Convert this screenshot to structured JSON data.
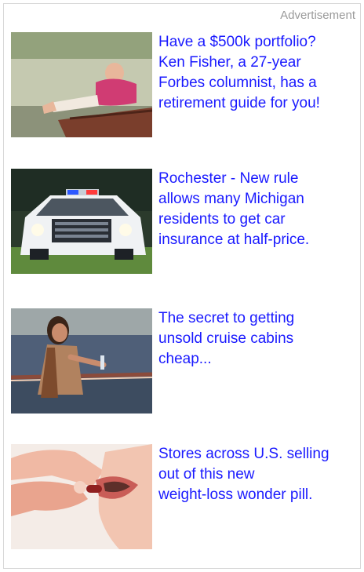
{
  "header": {
    "ad_label": "Advertisement"
  },
  "ads": [
    {
      "text": "Have a $500k portfolio?\nKen Fisher, a 27-year\nForbes columnist, has a\nretirement guide for you!",
      "icon": "lakeside-man-image"
    },
    {
      "text": "Rochester - New rule\nallows many Michigan\nresidents to get car\ninsurance at half-price.",
      "icon": "police-car-image"
    },
    {
      "text": "The secret to getting\nunsold cruise cabins\ncheap...",
      "icon": "cruise-woman-image"
    },
    {
      "text": "Stores across U.S. selling\nout of this new\nweight-loss wonder pill.",
      "icon": "pill-mouth-image"
    }
  ],
  "colors": {
    "link": "#1a1aff",
    "label": "#9a9a9a"
  }
}
